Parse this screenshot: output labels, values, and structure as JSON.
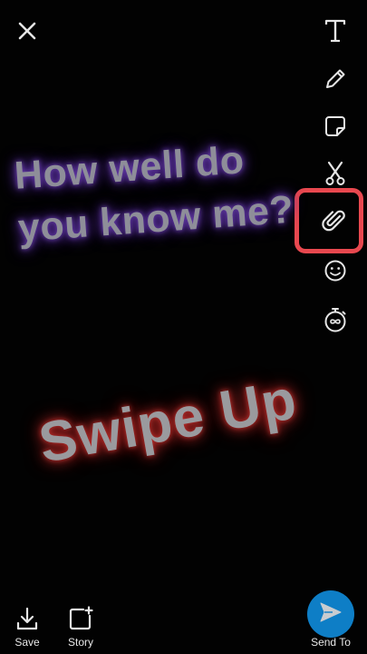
{
  "captions": {
    "question_line1": "How well do",
    "question_line2": "you know me?",
    "swipe": "Swipe Up"
  },
  "toolbar": {
    "tools": [
      "text-tool",
      "pencil-tool",
      "sticker-tool",
      "scissors-tool",
      "attachment-tool",
      "emoji-tool",
      "timer-tool"
    ],
    "highlighted": "attachment-tool",
    "highlight_color": "#e8484f"
  },
  "bottom_bar": {
    "save_label": "Save",
    "story_label": "Story",
    "send_label": "Send To",
    "send_color": "#0e7ec6"
  },
  "colors": {
    "background": "#020202",
    "icon": "#e6e6e6",
    "question_glow": "#6a3fb0",
    "swipe_glow": "#c0302e"
  }
}
